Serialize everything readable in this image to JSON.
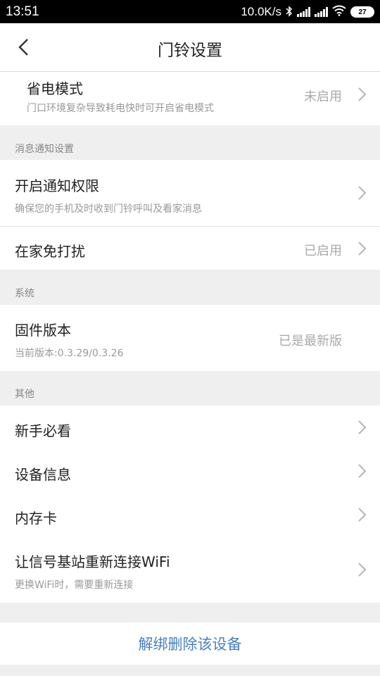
{
  "status_bar": {
    "time": "13:51",
    "speed": "10.0K/s",
    "battery": "27",
    "icons": [
      "bluetooth-icon",
      "signal-icon",
      "signal-icon",
      "wifi-icon",
      "battery-icon"
    ]
  },
  "header": {
    "title": "门铃设置",
    "back_icon": "chevron-left-icon"
  },
  "power_saving": {
    "title": "省电模式",
    "subtitle": "门口环境复杂导致耗电快时可开启省电模式",
    "value": "未启用"
  },
  "notification_section": {
    "header": "消息通知设置",
    "items": [
      {
        "title": "开启通知权限",
        "subtitle": "确保您的手机及时收到门铃呼叫及看家消息"
      },
      {
        "title": "在家免打扰",
        "value": "已启用"
      }
    ]
  },
  "system_section": {
    "header": "系统",
    "firmware": {
      "title": "固件版本",
      "subtitle": "当前版本:0.3.29/0.3.26",
      "value": "已是最新版"
    }
  },
  "other_section": {
    "header": "其他",
    "items": [
      {
        "title": "新手必看"
      },
      {
        "title": "设备信息"
      },
      {
        "title": "内存卡"
      },
      {
        "title": "让信号基站重新连接WiFi",
        "subtitle": "更换WiFi时，需要重新连接"
      }
    ]
  },
  "unbind": {
    "label": "解绑删除该设备"
  },
  "colors": {
    "accent": "#4a7fc1",
    "background": "#efefef",
    "status_bar": "#000000"
  }
}
